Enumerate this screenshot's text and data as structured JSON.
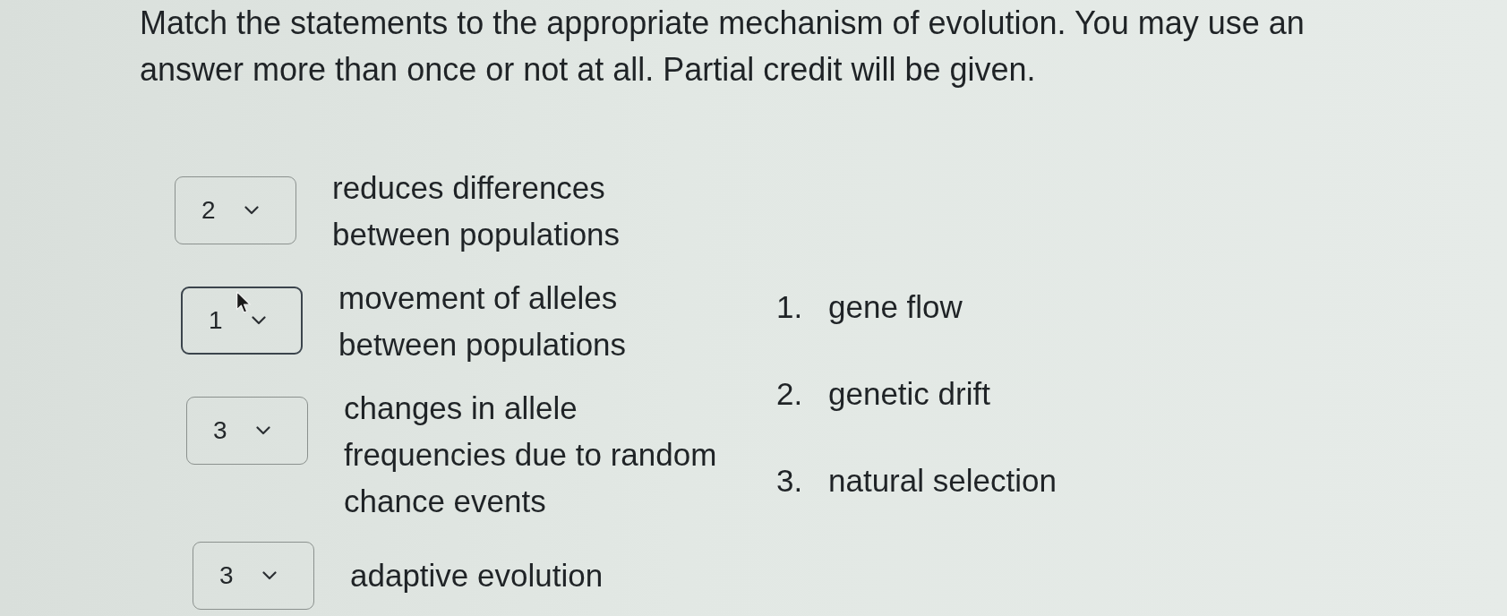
{
  "instructions": "Match the statements to the appropriate mechanism of evolution. You may use an\nanswer more than once or not at all. Partial credit will be given.",
  "matches": [
    {
      "selected_answer": "2",
      "focused": false,
      "hovered": false,
      "statement": "reduces differences\nbetween populations"
    },
    {
      "selected_answer": "1",
      "focused": true,
      "hovered": true,
      "statement": "movement of alleles\nbetween populations"
    },
    {
      "selected_answer": "3",
      "focused": false,
      "hovered": false,
      "statement": "changes in allele\nfrequencies due to random\nchance events"
    },
    {
      "selected_answer": "3",
      "focused": false,
      "hovered": false,
      "statement": "adaptive evolution"
    }
  ],
  "answers": [
    {
      "number": "1.",
      "label": "gene flow"
    },
    {
      "number": "2.",
      "label": "genetic drift"
    },
    {
      "number": "3.",
      "label": "natural selection"
    }
  ]
}
